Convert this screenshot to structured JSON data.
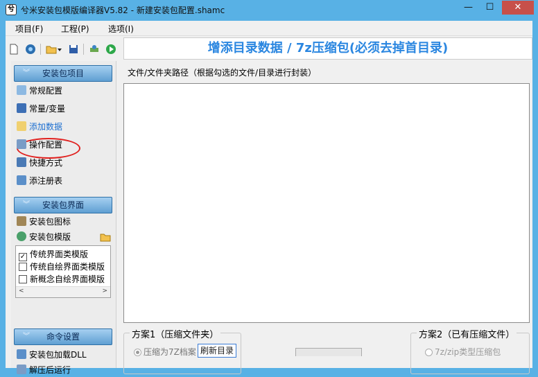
{
  "window": {
    "title": "兮米安装包模版编译器V5.82 - 新建安装包配置.shamc",
    "min_glyph": "—",
    "max_glyph": "☐",
    "close_glyph": "✕"
  },
  "menu": {
    "items": [
      "项目(F)",
      "工程(P)",
      "选项(I)"
    ]
  },
  "toolbar": {
    "icons": [
      "new-file-icon",
      "globe-icon",
      "open-folder-icon",
      "dropdown-arrow-icon",
      "save-icon",
      "build-icon",
      "run-icon"
    ]
  },
  "sidebar": {
    "groups": [
      {
        "label": "安装包项目"
      },
      {
        "label": "安装包界面"
      },
      {
        "label": "命令设置"
      }
    ],
    "project_items": [
      "常规配置",
      "常量/变量",
      "添加数据",
      "操作配置",
      "快捷方式",
      "添注册表"
    ],
    "ui_items": [
      "安装包图标",
      "安装包模版"
    ],
    "templates": [
      {
        "label": "传统界面类模版",
        "checked": true
      },
      {
        "label": "传统自绘界面类模版",
        "checked": false
      },
      {
        "label": "新概念自绘界面模版",
        "checked": false
      }
    ],
    "command_items": [
      "安装包加载DLL",
      "解压后运行"
    ],
    "check_glyph": "✓",
    "scroll_left": "<",
    "scroll_right": ">"
  },
  "main": {
    "header": "增添目录数据 / 7z压缩包(必须去掉首目录)",
    "path_label": "文件/文件夹路径（根据勾选的文件/目录进行封装）",
    "scheme1": {
      "legend": "方案1（压缩文件夹）",
      "option": "压缩为7Z档案",
      "refresh_button": "刷新目录"
    },
    "scheme2": {
      "legend": "方案2（已有压缩文件）",
      "option": "7z/zip类型压缩包"
    }
  },
  "colors": {
    "titlebar": "#58b1e5",
    "close": "#c7504a",
    "header_text": "#2a86e0",
    "group_header": "#5f9fd2",
    "active_item": "#1d6fd0",
    "highlight_ellipse": "#e0201e"
  }
}
